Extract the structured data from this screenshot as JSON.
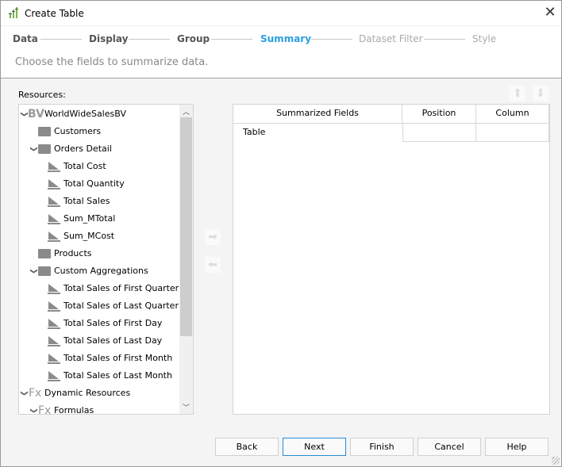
{
  "window": {
    "title": "Create Table",
    "close_icon": "close-icon",
    "app_icon": "chart-bars-icon"
  },
  "steps": [
    {
      "label": "Data",
      "state": "done"
    },
    {
      "label": "Display",
      "state": "done"
    },
    {
      "label": "Group",
      "state": "done"
    },
    {
      "label": "Summary",
      "state": "active"
    },
    {
      "label": "Dataset Filter",
      "state": "future"
    },
    {
      "label": "Style",
      "state": "future"
    }
  ],
  "description": "Choose the fields to summarize data.",
  "resources": {
    "label": "Resources:",
    "items": [
      {
        "label": "WorldWideSalesBV",
        "icon": "business-view-icon",
        "level": 0,
        "expanded": true
      },
      {
        "label": "Customers",
        "icon": "folder-icon",
        "level": 1
      },
      {
        "label": "Orders Detail",
        "icon": "folder-open-icon",
        "level": 1,
        "expanded": true
      },
      {
        "label": "Total Cost",
        "icon": "measure-icon",
        "level": 2
      },
      {
        "label": "Total Quantity",
        "icon": "measure-icon",
        "level": 2
      },
      {
        "label": "Total Sales",
        "icon": "measure-icon",
        "level": 2
      },
      {
        "label": "Sum_MTotal",
        "icon": "measure-icon",
        "level": 2
      },
      {
        "label": "Sum_MCost",
        "icon": "measure-icon",
        "level": 2
      },
      {
        "label": "Products",
        "icon": "folder-icon",
        "level": 1
      },
      {
        "label": "Custom Aggregations",
        "icon": "folder-open-icon",
        "level": 1,
        "expanded": true
      },
      {
        "label": "Total Sales of First Quarter",
        "icon": "measure-icon",
        "level": 2
      },
      {
        "label": "Total Sales of Last Quarter",
        "icon": "measure-icon",
        "level": 2
      },
      {
        "label": "Total Sales of First Day",
        "icon": "measure-icon",
        "level": 2
      },
      {
        "label": "Total Sales of Last Day",
        "icon": "measure-icon",
        "level": 2
      },
      {
        "label": "Total Sales of First Month",
        "icon": "measure-icon",
        "level": 2
      },
      {
        "label": "Total Sales of Last Month",
        "icon": "measure-icon",
        "level": 2
      },
      {
        "label": "Dynamic Resources",
        "icon": "formula-icon",
        "level": 0,
        "expanded": true
      },
      {
        "label": "Formulas",
        "icon": "formula-icon",
        "level": 1,
        "expanded": true
      }
    ]
  },
  "summary_table": {
    "columns": [
      "Summarized Fields",
      "Position",
      "Column"
    ],
    "rows": [
      [
        "Table",
        "",
        ""
      ]
    ]
  },
  "buttons": {
    "back": "Back",
    "next": "Next",
    "finish": "Finish",
    "cancel": "Cancel",
    "help": "Help"
  },
  "colors": {
    "accent": "#2a9ee0"
  }
}
